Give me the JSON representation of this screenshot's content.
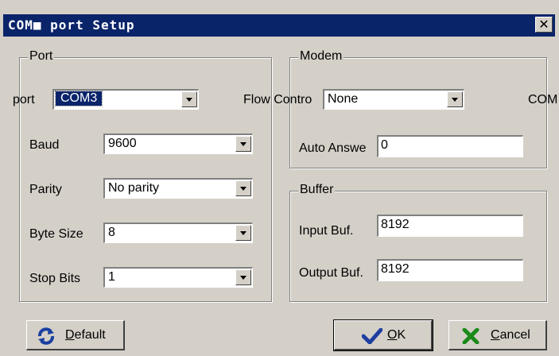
{
  "window": {
    "title": "COM■ port Setup",
    "close_glyph": "✕"
  },
  "port_group": {
    "legend": "Port",
    "port_label": "port",
    "port_value": "COM3",
    "baud_label": "Baud",
    "baud_value": "9600",
    "parity_label": "Parity",
    "parity_value": "No parity",
    "bytesize_label": "Byte Size",
    "bytesize_value": "8",
    "stopbits_label": "Stop Bits",
    "stopbits_value": "1"
  },
  "modem_group": {
    "legend": "Modem",
    "flow_label": "Flow Contro",
    "flow_value": "None",
    "com_label": "COM",
    "autoanswer_label": "Auto Answe",
    "autoanswer_value": "0"
  },
  "buffer_group": {
    "legend": "Buffer",
    "input_label": "Input Buf.",
    "input_value": "8192",
    "output_label": "Output Buf.",
    "output_value": "8192"
  },
  "buttons": {
    "default_mnemonic": "D",
    "default_rest": "efault",
    "ok_mnemonic": "O",
    "ok_rest": "K",
    "cancel_mnemonic": "C",
    "cancel_rest": "ancel"
  },
  "icons": {
    "default": "refresh-icon",
    "ok": "checkmark-icon",
    "cancel": "x-icon",
    "dropdown": "chevron-down-icon"
  },
  "colors": {
    "titlebar": "#0a246a",
    "face": "#d4d0c8",
    "ok_check": "#1f3f9f",
    "cancel_x": "#1a8a1a",
    "refresh": "#1a3fa0"
  }
}
